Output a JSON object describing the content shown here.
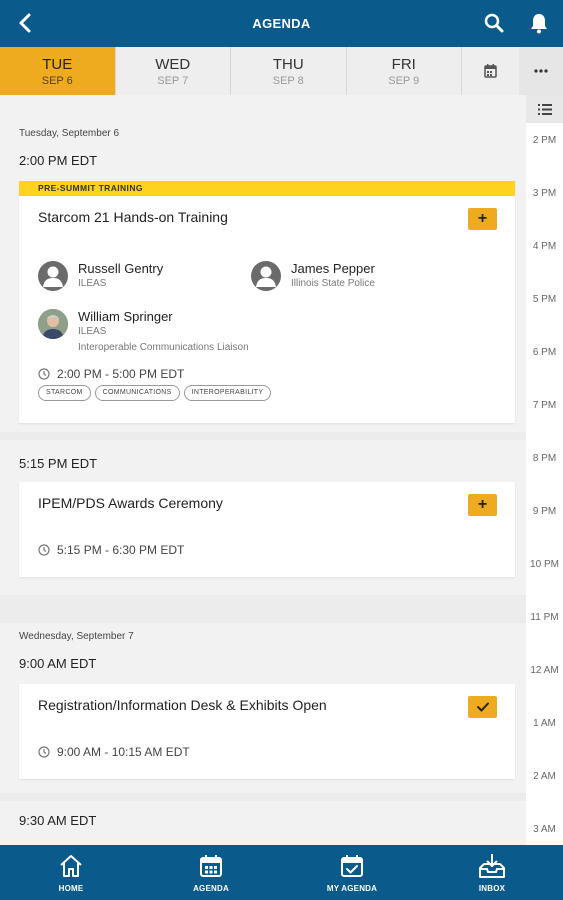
{
  "header": {
    "title": "AGENDA"
  },
  "days": [
    {
      "dow": "TUE",
      "date": "SEP 6"
    },
    {
      "dow": "WED",
      "date": "SEP 7"
    },
    {
      "dow": "THU",
      "date": "SEP 8"
    },
    {
      "dow": "FRI",
      "date": "SEP 9"
    }
  ],
  "timeline": [
    "2 PM",
    "3 PM",
    "4 PM",
    "5 PM",
    "6 PM",
    "7 PM",
    "8 PM",
    "9 PM",
    "10 PM",
    "11 PM",
    "12 AM",
    "1 AM",
    "2 AM",
    "3 AM"
  ],
  "day1": {
    "label": "Tuesday, September 6",
    "slot1": "2:00 PM EDT",
    "event1": {
      "banner": "PRE-SUMMIT TRAINING",
      "title": "Starcom 21 Hands-on Training",
      "add_label": "+",
      "speakers": [
        {
          "name": "Russell Gentry",
          "org": "ILEAS"
        },
        {
          "name": "James Pepper",
          "org": "Illinois State Police"
        },
        {
          "name": "William Springer",
          "org": "ILEAS",
          "role": "Interoperable Communications Liaison"
        }
      ],
      "time": "2:00 PM - 5:00 PM EDT",
      "tags": [
        "STARCOM",
        "COMMUNICATIONS",
        "INTEROPERABILITY"
      ]
    },
    "slot2": "5:15 PM EDT",
    "event2": {
      "title": "IPEM/PDS Awards Ceremony",
      "add_label": "+",
      "time": "5:15 PM - 6:30 PM EDT"
    }
  },
  "day2": {
    "label": "Wednesday, September 7",
    "slot1": "9:00 AM EDT",
    "event1": {
      "title": "Registration/Information Desk & Exhibits Open",
      "time": "9:00 AM - 10:15 AM EDT"
    },
    "slot2": "9:30 AM EDT"
  },
  "nav": [
    {
      "label": "HOME",
      "icon": "home-icon"
    },
    {
      "label": "AGENDA",
      "icon": "calendar-icon"
    },
    {
      "label": "MY AGENDA",
      "icon": "calendar-check-icon"
    },
    {
      "label": "INBOX",
      "icon": "inbox-icon"
    }
  ],
  "colors": {
    "primary": "#0a5a8c",
    "accent": "#eeab1f",
    "banner": "#ffd21f"
  }
}
